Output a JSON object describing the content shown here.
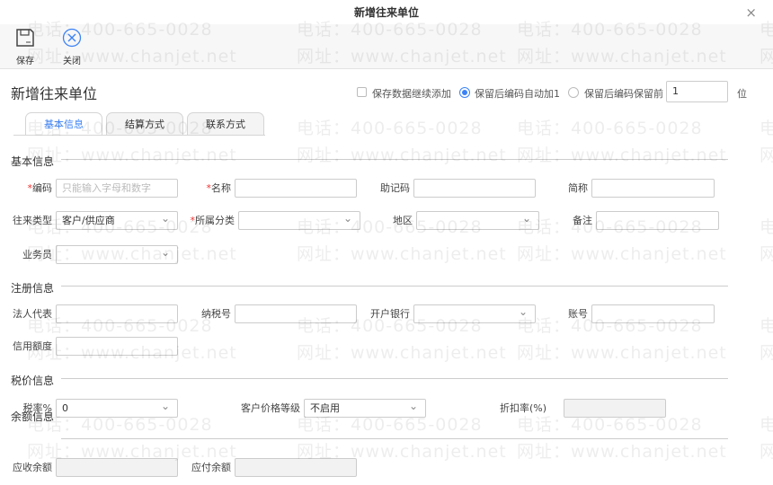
{
  "window": {
    "title": "新增往来单位",
    "close": "×"
  },
  "toolbar": {
    "save": "保存",
    "close": "关闭"
  },
  "heading": "新增往来单位",
  "options": {
    "continue_add": "保存数据继续添加",
    "auto_inc": "保留后编码自动加1",
    "keep_prefix": "保留后编码保留前",
    "prefix_value": "1",
    "prefix_unit": "位",
    "selected": "auto_inc"
  },
  "tabs": [
    "基本信息",
    "结算方式",
    "联系方式"
  ],
  "sections": {
    "basic": "基本信息",
    "register": "注册信息",
    "tax": "税价信息",
    "balance": "余额信息"
  },
  "fields": {
    "code": {
      "label": "编码",
      "placeholder": "只能输入字母和数字"
    },
    "name": {
      "label": "名称"
    },
    "mnemonic": {
      "label": "助记码"
    },
    "short": {
      "label": "简称"
    },
    "type": {
      "label": "往来类型",
      "value": "客户/供应商"
    },
    "category": {
      "label": "所属分类"
    },
    "region": {
      "label": "地区"
    },
    "remark": {
      "label": "备注"
    },
    "salesman": {
      "label": "业务员"
    },
    "legal": {
      "label": "法人代表"
    },
    "taxno": {
      "label": "纳税号"
    },
    "bank": {
      "label": "开户银行"
    },
    "account": {
      "label": "账号"
    },
    "credit": {
      "label": "信用额度"
    },
    "taxrate": {
      "label": "税率%",
      "value": "0"
    },
    "pricelevel": {
      "label": "客户价格等级",
      "value": "不启用"
    },
    "discount": {
      "label": "折扣率(%)"
    },
    "receivable": {
      "label": "应收余额"
    },
    "payable": {
      "label": "应付余额"
    }
  },
  "watermark": {
    "phone": "电话：400-665-0028",
    "site": "网址：www.chanjet.net"
  }
}
